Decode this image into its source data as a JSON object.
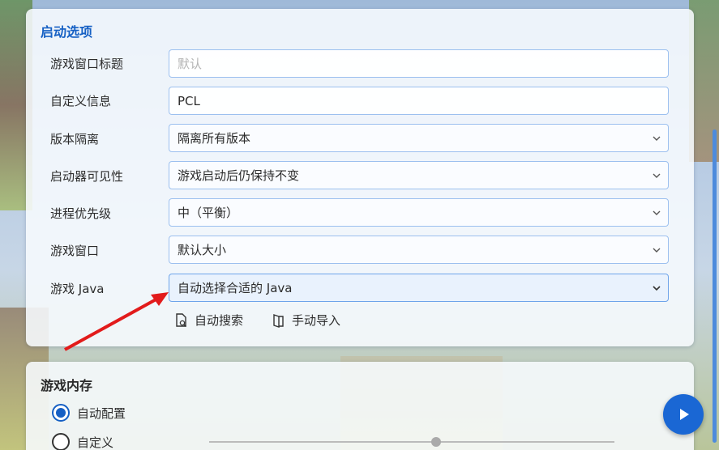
{
  "colors": {
    "accent": "#1660c4",
    "play_button": "#1a67d4",
    "annotation_arrow": "#e21b1b"
  },
  "launch_options": {
    "title": "启动选项",
    "rows": [
      {
        "label": "游戏窗口标题",
        "placeholder": "默认"
      },
      {
        "label": "自定义信息",
        "value": "PCL"
      },
      {
        "label": "版本隔离",
        "value": "隔离所有版本"
      },
      {
        "label": "启动器可见性",
        "value": "游戏启动后仍保持不变"
      },
      {
        "label": "进程优先级",
        "value": "中（平衡）"
      },
      {
        "label": "游戏窗口",
        "value": "默认大小"
      },
      {
        "label": "游戏 Java",
        "value": "自动选择合适的 Java"
      }
    ],
    "auto_search_label": "自动搜索",
    "manual_import_label": "手动导入"
  },
  "game_memory": {
    "title": "游戏内存",
    "auto_config_label": "自动配置",
    "custom_label": "自定义",
    "selected": "自动配置"
  },
  "icons": [
    "file-search-icon",
    "book-open-icon",
    "chevron-down-icon",
    "play-icon"
  ]
}
